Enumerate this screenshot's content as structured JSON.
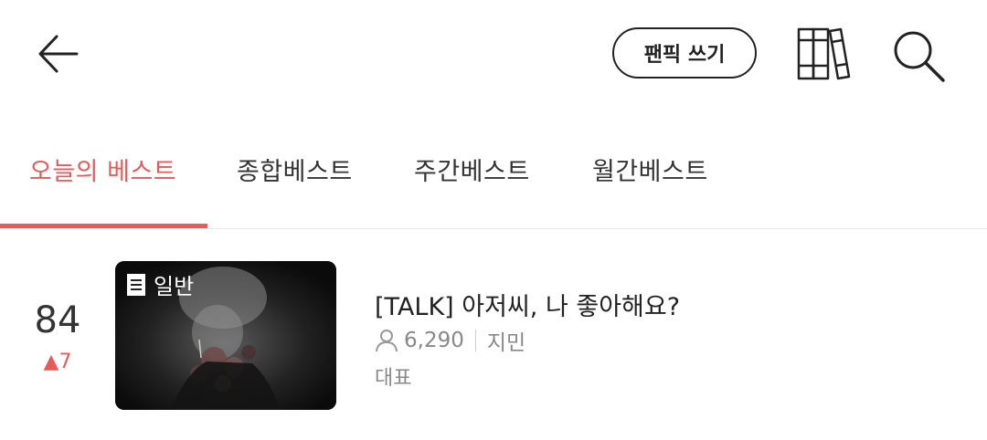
{
  "header": {
    "write_label": "팬픽 쓰기",
    "icons": [
      "back-arrow-icon",
      "library-icon",
      "search-icon"
    ]
  },
  "tabs": [
    {
      "label": "오늘의 베스트",
      "active": true
    },
    {
      "label": "종합베스트",
      "active": false
    },
    {
      "label": "주간베스트",
      "active": false
    },
    {
      "label": "월간베스트",
      "active": false
    }
  ],
  "colors": {
    "accent": "#e85a5a",
    "text": "#222222",
    "muted": "#888888"
  },
  "list": [
    {
      "rank": "84",
      "rank_change": "▲7",
      "badge": "일반",
      "title": "[TALK] 아저씨, 나 좋아해요?",
      "views": "6,290",
      "author": "지민",
      "tag": "대표"
    }
  ]
}
